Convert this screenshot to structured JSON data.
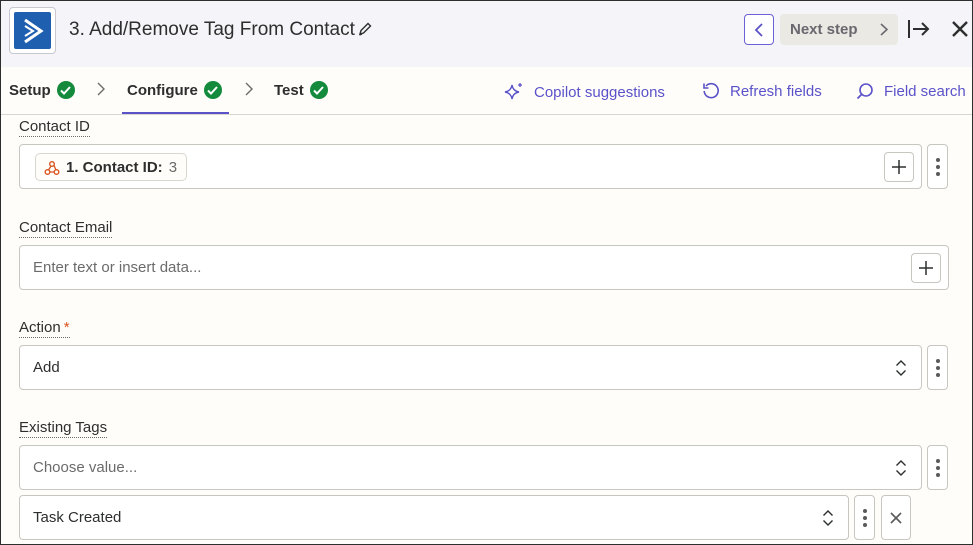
{
  "header": {
    "step_title": "3. Add/Remove Tag From Contact",
    "next_step_label": "Next step",
    "logo_color": "#1f5fb0"
  },
  "tabs": [
    {
      "label": "Setup",
      "status": "complete"
    },
    {
      "label": "Configure",
      "status": "complete",
      "active": true
    },
    {
      "label": "Test",
      "status": "complete"
    }
  ],
  "tools": {
    "copilot": "Copilot suggestions",
    "refresh": "Refresh fields",
    "search": "Field search"
  },
  "fields": {
    "contact_id": {
      "label": "Contact ID",
      "pill_label": "1. Contact ID:",
      "pill_value": "3"
    },
    "contact_email": {
      "label": "Contact Email",
      "placeholder": "Enter text or insert data..."
    },
    "action": {
      "label": "Action",
      "required_mark": "*",
      "value": "Add"
    },
    "existing_tags": {
      "label": "Existing Tags",
      "placeholder": "Choose value...",
      "selected": "Task Created"
    }
  },
  "colors": {
    "accent": "#5a52c9",
    "success": "#138a3c",
    "required": "#d9531e"
  }
}
